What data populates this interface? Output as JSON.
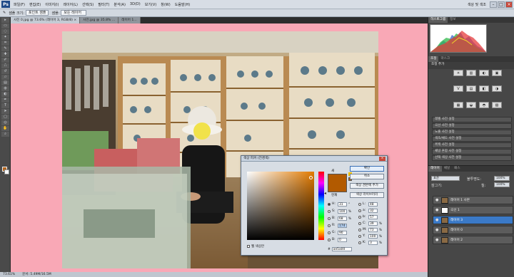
{
  "menubar": {
    "logo": "Ps",
    "items": [
      "파일(F)",
      "편집(E)",
      "이미지(I)",
      "레이어(L)",
      "선택(S)",
      "필터(T)",
      "분석(A)",
      "3D(D)",
      "보기(V)",
      "창(W)",
      "도움말(H)"
    ],
    "workspace": "색상 및 색조"
  },
  "options": {
    "tool_label": "샘플 크기:",
    "tool_value": "포인트 샘플",
    "sample_label": "샘플:",
    "sample_value": "모든 레이어"
  },
  "doc": {
    "tabs": [
      "사진 0.jpg @ 73.6% (레이어 3, RGB/8) ×",
      "사진.jpg @ 35.8% ...",
      "레이어 1..."
    ],
    "zoom": "73.61%",
    "docsize": "문서: 5.49M/16.5M"
  },
  "right": {
    "hist_tabs": [
      "히스토그램",
      "정보"
    ],
    "adj_tabs": [
      "조정",
      "마스크"
    ],
    "adj_label": "조정 추가",
    "adj_icons": [
      "☀",
      "▥",
      "◐",
      "▣",
      "V",
      "▤",
      "◧",
      "◑",
      "▦",
      "◒",
      "◓",
      "▧"
    ],
    "presets": [
      "레벨 사전 설정",
      "곡선 사전 설정",
      "노출 사전 설정",
      "색조/채도 사전 설정",
      "흑백 사전 설정",
      "채널 혼합 사전 설정",
      "선택 색상 사전 설정"
    ],
    "layers_tabs": [
      "레이어",
      "채널",
      "패스"
    ],
    "blend": "표준",
    "opacity_label": "불투명도:",
    "opacity": "100%",
    "lock_label": "잠그기:",
    "fill_label": "칠:",
    "fill": "100%",
    "layers": [
      {
        "name": "레이어 1 사본",
        "selected": false,
        "white": false
      },
      {
        "name": "곡선 1",
        "selected": false,
        "white": true
      },
      {
        "name": "레이어 3",
        "selected": true,
        "white": false
      },
      {
        "name": "레이어 0",
        "selected": false,
        "white": false
      },
      {
        "name": "레이어 2",
        "selected": false,
        "white": false
      }
    ]
  },
  "picker": {
    "title": "색상 피커 (전경색)",
    "ok": "확인",
    "cancel": "취소",
    "add_swatch": "색상 견본에 추가",
    "libraries": "색상 라이브러리",
    "new_label": "새",
    "current_label": "현재",
    "color": "#b25a00",
    "fields_left": [
      {
        "lab": "H:",
        "val": "31",
        "unit": "°",
        "on": true
      },
      {
        "lab": "S:",
        "val": "100",
        "unit": "%",
        "on": false
      },
      {
        "lab": "B:",
        "val": "68",
        "unit": "%",
        "on": false
      },
      {
        "lab": "R:",
        "val": "174",
        "unit": "",
        "on": false,
        "hl": true
      },
      {
        "lab": "G:",
        "val": "90",
        "unit": "",
        "on": false
      },
      {
        "lab": "B:",
        "val": "0",
        "unit": "",
        "on": false
      }
    ],
    "fields_right": [
      {
        "lab": "L:",
        "val": "48",
        "unit": ""
      },
      {
        "lab": "a:",
        "val": "32",
        "unit": ""
      },
      {
        "lab": "b:",
        "val": "57",
        "unit": ""
      },
      {
        "lab": "C:",
        "val": "39",
        "unit": "%"
      },
      {
        "lab": "M:",
        "val": "73",
        "unit": "%"
      },
      {
        "lab": "Y:",
        "val": "100",
        "unit": "%"
      },
      {
        "lab": "K:",
        "val": "3",
        "unit": "%"
      }
    ],
    "hex": "ae5a00",
    "web_only": "웹 색상만"
  }
}
